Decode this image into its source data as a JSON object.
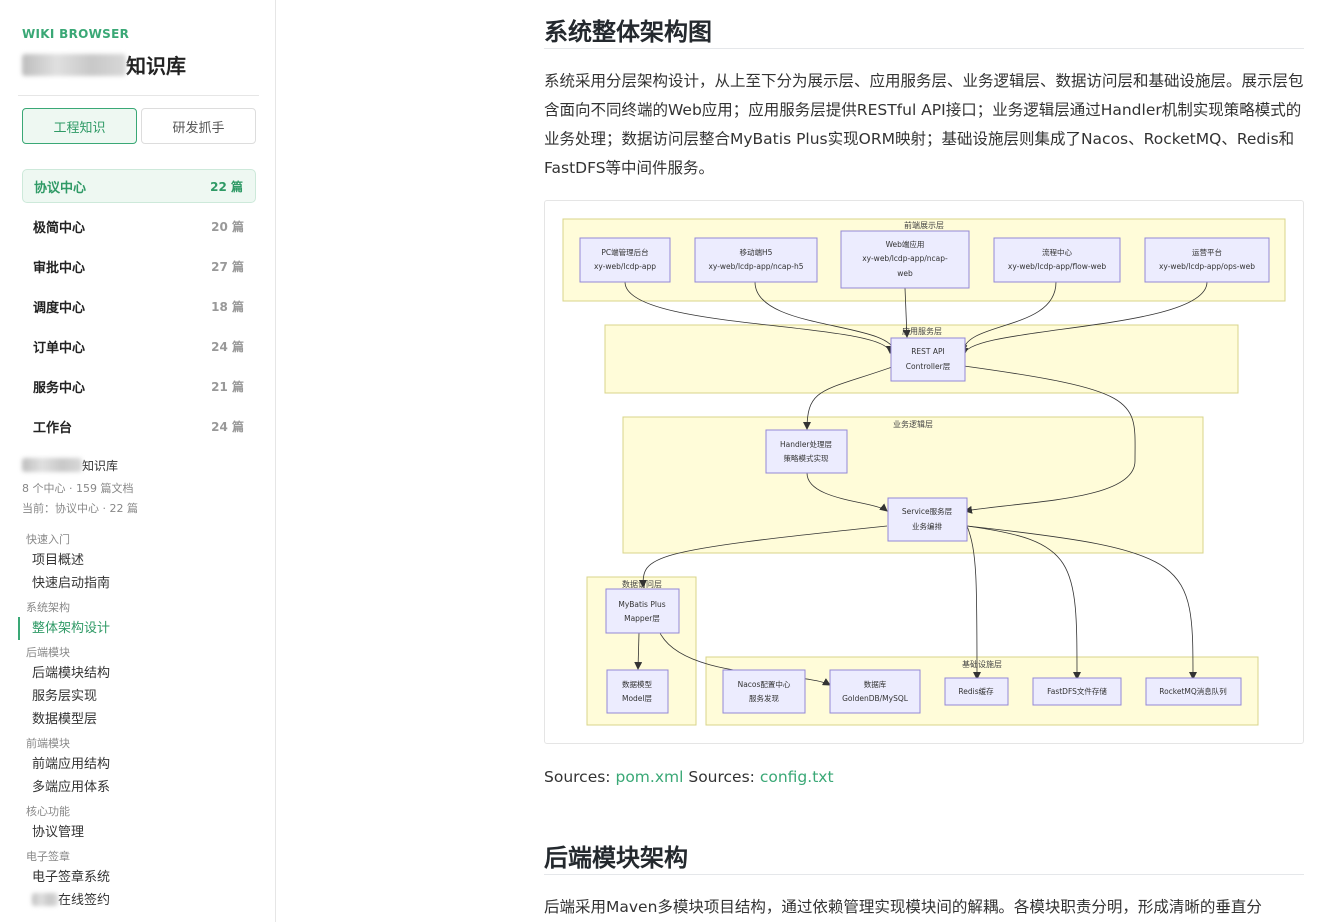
{
  "sidebar": {
    "brand": "WIKI BROWSER",
    "kb_title_suffix": "知识库",
    "tabs": [
      {
        "label": "工程知识",
        "active": true
      },
      {
        "label": "研发抓手",
        "active": false
      }
    ],
    "centers": [
      {
        "name": "协议中心",
        "count": "22 篇"
      },
      {
        "name": "极简中心",
        "count": "20 篇"
      },
      {
        "name": "审批中心",
        "count": "27 篇"
      },
      {
        "name": "调度中心",
        "count": "18 篇"
      },
      {
        "name": "订单中心",
        "count": "24 篇"
      },
      {
        "name": "服务中心",
        "count": "21 篇"
      },
      {
        "name": "工作台",
        "count": "24 篇"
      }
    ],
    "kb_info_suffix": "知识库",
    "kb_stats": "8 个中心 · 159 篇文档",
    "kb_current": "当前：协议中心 · 22 篇",
    "nav": [
      {
        "group": "快速入门",
        "items": [
          "项目概述",
          "快速启动指南"
        ]
      },
      {
        "group": "系统架构",
        "items": [
          "整体架构设计"
        ]
      },
      {
        "group": "后端模块",
        "items": [
          "后端模块结构",
          "服务层实现",
          "数据模型层"
        ]
      },
      {
        "group": "前端模块",
        "items": [
          "前端应用结构",
          "多端应用体系"
        ]
      },
      {
        "group": "核心功能",
        "items": [
          "协议管理"
        ]
      },
      {
        "group": "电子签章",
        "items": [
          "电子签章系统",
          "在线签约"
        ]
      }
    ],
    "nav_active": "整体架构设计"
  },
  "main": {
    "section1_title": "系统整体架构图",
    "section1_para": "系统采用分层架构设计，从上至下分为展示层、应用服务层、业务逻辑层、数据访问层和基础设施层。展示层包含面向不同终端的Web应用；应用服务层提供RESTful API接口；业务逻辑层通过Handler机制实现策略模式的业务处理；数据访问层整合MyBatis Plus实现ORM映射；基础设施层则集成了Nacos、RocketMQ、Redis和FastDFS等中间件服务。",
    "sources_label_1": "Sources:",
    "sources_link_1": "pom.xml",
    "sources_label_2": "Sources:",
    "sources_link_2": "config.txt",
    "section2_title": "后端模块架构",
    "section2_para": "后端采用Maven多模块项目结构，通过依赖管理实现模块间的解耦。各模块职责分明，形成清晰的垂直分"
  },
  "diagram": {
    "layers": {
      "frontend": "前端展示层",
      "app": "应用服务层",
      "biz": "业务逻辑层",
      "data": "数据访问层",
      "infra": "基础设施层"
    },
    "nodes": {
      "pc": [
        "PC端管理后台",
        "xy-web/lcdp-app"
      ],
      "h5": [
        "移动端H5",
        "xy-web/lcdp-app/ncap-h5"
      ],
      "web": [
        "Web端应用",
        "xy-web/lcdp-app/ncap-",
        "web"
      ],
      "flow": [
        "流程中心",
        "xy-web/lcdp-app/flow-web"
      ],
      "ops": [
        "运营平台",
        "xy-web/lcdp-app/ops-web"
      ],
      "rest": [
        "REST API",
        "Controller层"
      ],
      "handler": [
        "Handler处理层",
        "策略模式实现"
      ],
      "service": [
        "Service服务层",
        "业务编排"
      ],
      "mybatis": [
        "MyBatis Plus",
        "Mapper层"
      ],
      "model": [
        "数据模型",
        "Model层"
      ],
      "nacos": [
        "Nacos配置中心",
        "服务发现"
      ],
      "db": [
        "数据库",
        "GoldenDB/MySQL"
      ],
      "redis": [
        "Redis缓存"
      ],
      "fastdfs": [
        "FastDFS文件存储"
      ],
      "mq": [
        "RocketMQ消息队列"
      ]
    },
    "colors": {
      "layer_fill": "#fffcd9",
      "layer_stroke": "#d8d48a",
      "node_fill": "#ececfe",
      "node_stroke": "#9388d6",
      "accent": "#3aa876"
    }
  }
}
